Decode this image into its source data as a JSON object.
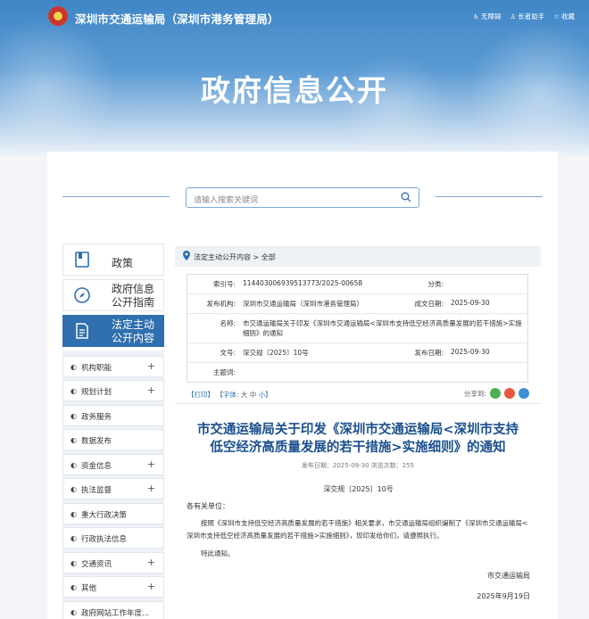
{
  "header": {
    "site_title": "深圳市交通运输局（深圳市港务管理局）",
    "links": [
      {
        "icon": "accessibility-icon",
        "label": "无障碍"
      },
      {
        "icon": "elder-helper-icon",
        "label": "长者助手"
      },
      {
        "icon": "star-icon",
        "label": "收藏"
      }
    ],
    "banner_title": "政府信息公开"
  },
  "search": {
    "placeholder": "请输入搜索关键词"
  },
  "sidebar": {
    "top": [
      {
        "label": "政策",
        "icon": "policy-book-icon"
      },
      {
        "label": "政府信息公开指南",
        "icon": "compass-icon"
      },
      {
        "label": "法定主动公开内容",
        "icon": "document-list-icon",
        "active": true
      }
    ],
    "items": [
      {
        "label": "机构职能",
        "expandable": true
      },
      {
        "label": "规划计划",
        "expandable": true
      },
      {
        "label": "政务服务",
        "expandable": false
      },
      {
        "label": "数据发布",
        "expandable": false
      },
      {
        "label": "资金信息",
        "expandable": true
      },
      {
        "label": "执法监督",
        "expandable": true
      },
      {
        "label": "重大行政决策",
        "expandable": false
      },
      {
        "label": "行政执法信息",
        "expandable": false
      },
      {
        "label": "交通资讯",
        "expandable": true
      },
      {
        "label": "其他",
        "expandable": true
      },
      {
        "label": "政府网站工作年度...",
        "expandable": false
      }
    ]
  },
  "breadcrumb": "法定主动公开内容 >  全部",
  "meta": {
    "index_label": "索引号:",
    "index_value": "11440300693951377З/2025-00658",
    "category_label": "分类:",
    "category_value": "",
    "org_label": "发布机构:",
    "org_value": "深圳市交通运输局（深圳市港务管理局）",
    "date_label": "成文日期:",
    "date_value": "2025-09-30",
    "name_label": "名称:",
    "name_value": "市交通运输局关于印发《深圳市交通运输局<深圳市支持低空经济高质量发展的若干措施>实施细则》的通知",
    "docno_label": "文号:",
    "docno_value": "深交规〔2025〕10号",
    "pub_label": "发布日期:",
    "pub_value": "2025-09-30",
    "keywords_label": "主题词:",
    "keywords_value": ""
  },
  "tools": {
    "print": "【打印】",
    "font_label": "【字体:",
    "font_large": "大",
    "font_medium": "中",
    "font_small": "小】",
    "share_label": "分享到:"
  },
  "document": {
    "title_line1": "市交通运输局关于印发《深圳市交通运输局<深圳市支持",
    "title_line2": "低空经济高质量发展的若干措施>实施细则》的通知",
    "date_line": "发布日期：2025-09-30   浏览次数：255",
    "doc_number": "深交规〔2025〕10号",
    "salutation": "各有关单位：",
    "paragraph1": "按照《深圳市支持低空经济高质量发展的若干措施》相关要求，市交通运输局组织编制了《深圳市交通运输局<深圳市支持低空经济高质量发展的若干措施>实施细则》，现印发给你们，请遵照执行。",
    "paragraph2": "特此通知。",
    "signature": "市交通运输局",
    "sign_date": "2025年9月19日"
  }
}
